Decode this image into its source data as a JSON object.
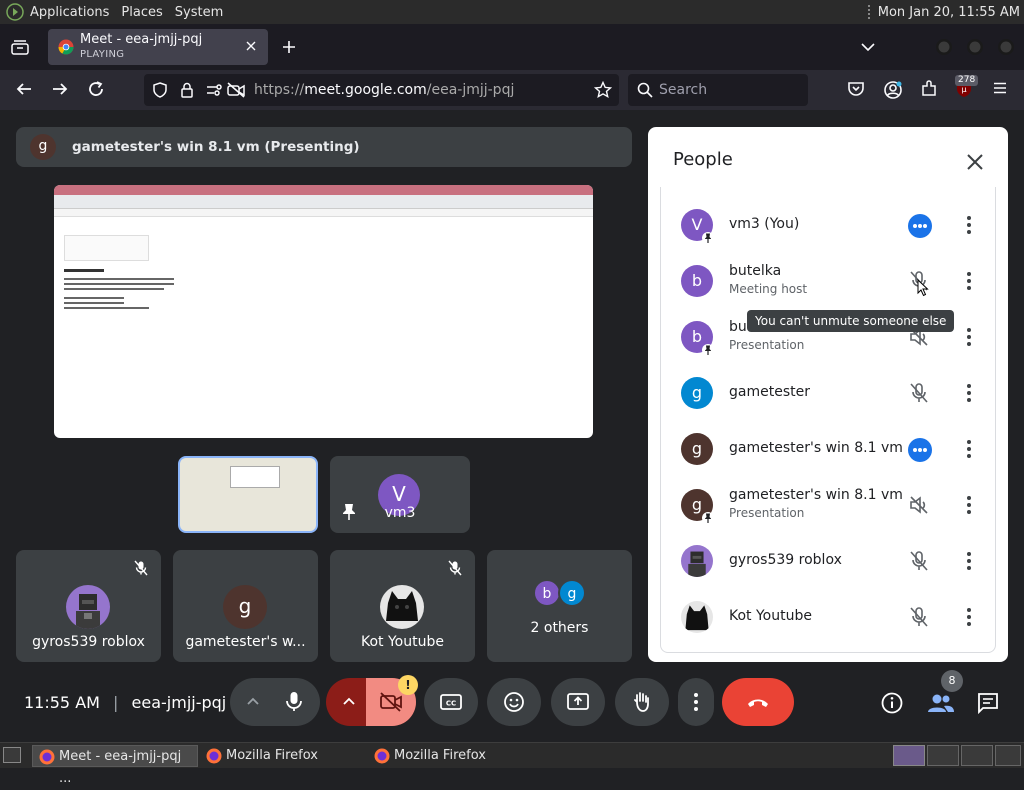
{
  "desktop": {
    "menus": [
      "Applications",
      "Places",
      "System"
    ],
    "clock": "Mon Jan 20, 11:55 AM"
  },
  "browser": {
    "tab": {
      "title": "Meet - eea-jmjj-pqj",
      "status": "PLAYING"
    },
    "url": {
      "prefix": "https://",
      "host": "meet.google.com",
      "path": "/eea-jmjj-pqj"
    },
    "search_placeholder": "Search",
    "extension_badge": "278"
  },
  "meet": {
    "presenting_banner": {
      "avatar_letter": "g",
      "text": "gametester's win 8.1 vm (Presenting)"
    },
    "tiles": [
      {
        "id": "vm3",
        "name": "vm3",
        "avatar_letter": "V",
        "color": "#7e57c2"
      },
      {
        "id": "gyros",
        "name": "gyros539 roblox",
        "muted": true
      },
      {
        "id": "gametester-win",
        "name": "gametester's w...",
        "avatar_letter": "g",
        "color": "#4e342e"
      },
      {
        "id": "kot",
        "name": "Kot Youtube",
        "muted": true
      },
      {
        "id": "others",
        "name": "2 others",
        "avatars": [
          "b",
          "g"
        ]
      }
    ],
    "people_panel": {
      "title": "People",
      "tooltip": "You can't unmute someone else",
      "participants": [
        {
          "name": "vm3 (You)",
          "sub": "",
          "letter": "V",
          "color": "#7e57c2",
          "status": "speaking",
          "pinned": true
        },
        {
          "name": "butelka",
          "sub": "Meeting host",
          "letter": "b",
          "color": "#7e57c2",
          "status": "muted"
        },
        {
          "name": "butelka",
          "sub": "Presentation",
          "letter": "b",
          "color": "#7e57c2",
          "status": "audio-off",
          "pinned": true
        },
        {
          "name": "gametester",
          "sub": "",
          "letter": "g",
          "color": "#0288d1",
          "status": "muted"
        },
        {
          "name": "gametester's win 8.1 vm",
          "sub": "",
          "letter": "g",
          "color": "#4e342e",
          "status": "speaking"
        },
        {
          "name": "gametester's win 8.1 vm",
          "sub": "Presentation",
          "letter": "g",
          "color": "#4e342e",
          "status": "audio-off",
          "pinned": true
        },
        {
          "name": "gyros539 roblox",
          "sub": "",
          "letter": "",
          "color": "#6f6f9f",
          "status": "muted"
        },
        {
          "name": "Kot Youtube",
          "sub": "",
          "letter": "",
          "color": "#111111",
          "status": "muted"
        }
      ]
    },
    "bottom": {
      "time": "11:55 AM",
      "separator": "|",
      "code": "eea-jmjj-pqj",
      "participant_count": "8",
      "camera_warning": "!"
    }
  },
  "taskbar": {
    "items": [
      "Meet - eea-jmjj-pqj ...",
      "Mozilla Firefox",
      "Mozilla Firefox"
    ]
  }
}
